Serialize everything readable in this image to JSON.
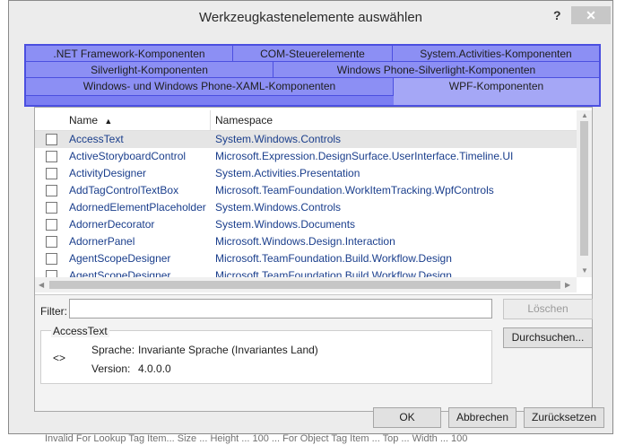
{
  "dialog": {
    "title": "Werkzeugkastenelemente auswählen",
    "help": "?",
    "close": "✕"
  },
  "tabs": {
    "row1": [
      ".NET Framework-Komponenten",
      "COM-Steuerelemente",
      "System.Activities-Komponenten"
    ],
    "row2": [
      "Silverlight-Komponenten",
      "Windows Phone-Silverlight-Komponenten"
    ],
    "row3": [
      "Windows- und Windows Phone-XAML-Komponenten",
      "WPF-Komponenten"
    ],
    "active": "WPF-Komponenten"
  },
  "list": {
    "columns": {
      "name": "Name",
      "name_sort_icon": "sort-up-icon",
      "namespace": "Namespace"
    },
    "rows": [
      {
        "name": "AccessText",
        "namespace": "System.Windows.Controls",
        "checked": false,
        "selected": true
      },
      {
        "name": "ActiveStoryboardControl",
        "namespace": "Microsoft.Expression.DesignSurface.UserInterface.Timeline.UI",
        "checked": false
      },
      {
        "name": "ActivityDesigner",
        "namespace": "System.Activities.Presentation",
        "checked": false
      },
      {
        "name": "AddTagControlTextBox",
        "namespace": "Microsoft.TeamFoundation.WorkItemTracking.WpfControls",
        "checked": false
      },
      {
        "name": "AdornedElementPlaceholder",
        "namespace": "System.Windows.Controls",
        "checked": false
      },
      {
        "name": "AdornerDecorator",
        "namespace": "System.Windows.Documents",
        "checked": false
      },
      {
        "name": "AdornerPanel",
        "namespace": "Microsoft.Windows.Design.Interaction",
        "checked": false
      },
      {
        "name": "AgentScopeDesigner",
        "namespace": "Microsoft.TeamFoundation.Build.Workflow.Design",
        "checked": false
      },
      {
        "name": "AgentScopeDesigner",
        "namespace": "Microsoft.TeamFoundation.Build.Workflow.Design",
        "checked": false
      }
    ]
  },
  "filter": {
    "label": "Filter:",
    "value": "",
    "clear_label": "Löschen"
  },
  "info": {
    "title": "AccessText",
    "icon": "<>",
    "language_label": "Sprache:",
    "language_value": "Invariante Sprache (Invariantes Land)",
    "version_label": "Version:",
    "version_value": "4.0.0.0",
    "browse_label": "Durchsuchen..."
  },
  "footer": {
    "ok": "OK",
    "cancel": "Abbrechen",
    "reset": "Zurücksetzen"
  },
  "background": {
    "bottom_text": "Invalid For Lookup Tag Item... Size ... Height ... 100 ... For Object Tag Item ... Top ... Width ... 100"
  },
  "colors": {
    "tab_overlay": "#7b7ef2",
    "tab_border": "#4b4fe0",
    "link_text": "#1a3e8c"
  }
}
